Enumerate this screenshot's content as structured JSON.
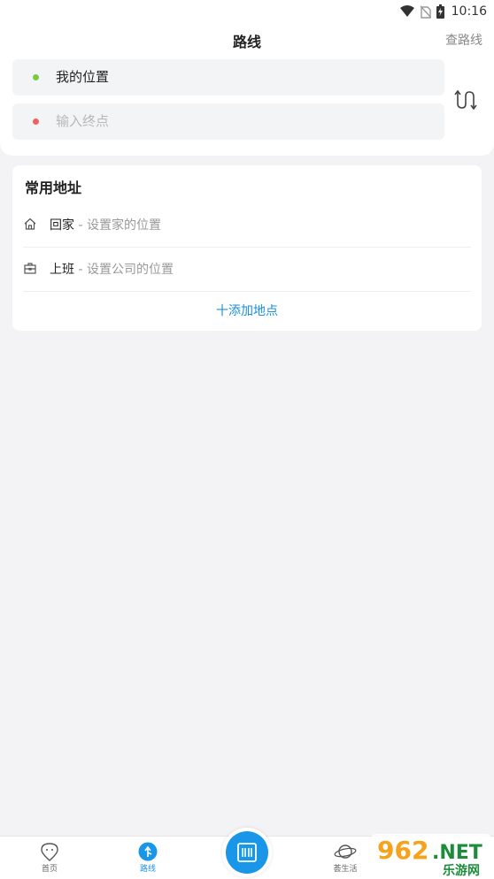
{
  "status_bar": {
    "time": "10:16",
    "icons": [
      "wifi-icon",
      "no-sim-icon",
      "battery-charging-icon"
    ]
  },
  "header": {
    "title": "路线",
    "query_label": "查路线",
    "origin": {
      "text": "我的位置",
      "dot_color": "#7ac943"
    },
    "destination": {
      "placeholder": "输入终点",
      "dot_color": "#f06060"
    },
    "swap_icon": "swap-route-icon"
  },
  "favorites": {
    "title": "常用地址",
    "items": [
      {
        "icon": "home-icon",
        "name": "回家",
        "sep": " - ",
        "hint": "设置家的位置"
      },
      {
        "icon": "briefcase-icon",
        "name": "上班",
        "sep": " - ",
        "hint": "设置公司的位置"
      }
    ],
    "add_label": "十添加地点"
  },
  "tabbar": {
    "tabs": [
      {
        "label": "首页",
        "icon": "home-face-icon",
        "active": false
      },
      {
        "label": "路线",
        "icon": "route-arrow-icon",
        "active": true
      },
      {
        "label": "",
        "icon": "scan-bus-card-icon",
        "active": false
      },
      {
        "label": "荟生活",
        "icon": "planet-icon",
        "active": false
      }
    ]
  },
  "watermark": {
    "text": "962.NET",
    "subtext": "乐游网"
  },
  "colors": {
    "accent": "#1a96e8",
    "page_bg": "#f3f3f5",
    "field_bg": "#f3f4f6",
    "link": "#1a8fdd"
  }
}
